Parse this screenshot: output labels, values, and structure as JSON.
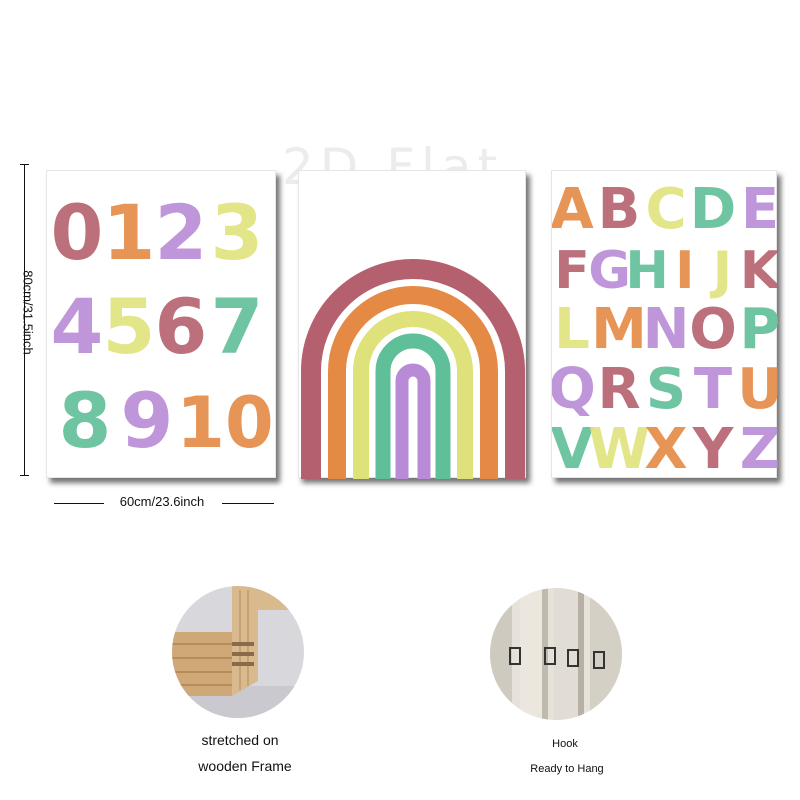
{
  "watermark": "2D Flat",
  "numbers_panel": {
    "glyphs": [
      "0",
      "1",
      "2",
      "3",
      "4",
      "5",
      "6",
      "7",
      "8",
      "9",
      "10"
    ]
  },
  "alphabet_panel": {
    "glyphs": [
      "A",
      "B",
      "C",
      "D",
      "E",
      "F",
      "G",
      "H",
      "I",
      "J",
      "K",
      "L",
      "M",
      "N",
      "O",
      "P",
      "Q",
      "R",
      "S",
      "T",
      "U",
      "V",
      "W",
      "X",
      "Y",
      "Z"
    ]
  },
  "dimensions": {
    "height": "80cm/31.5inch",
    "width": "60cm/23.6inch"
  },
  "feature_frame": {
    "caption_line1": "stretched on",
    "caption_line2": "wooden Frame"
  },
  "feature_hook": {
    "caption_line1": "Hook",
    "caption_line2": "Ready to Hang"
  },
  "colors": {
    "rose": "#b5606e",
    "orange": "#e48a45",
    "lavender": "#b98bd6",
    "yellow": "#dfe27b",
    "mint": "#5fbf98"
  }
}
